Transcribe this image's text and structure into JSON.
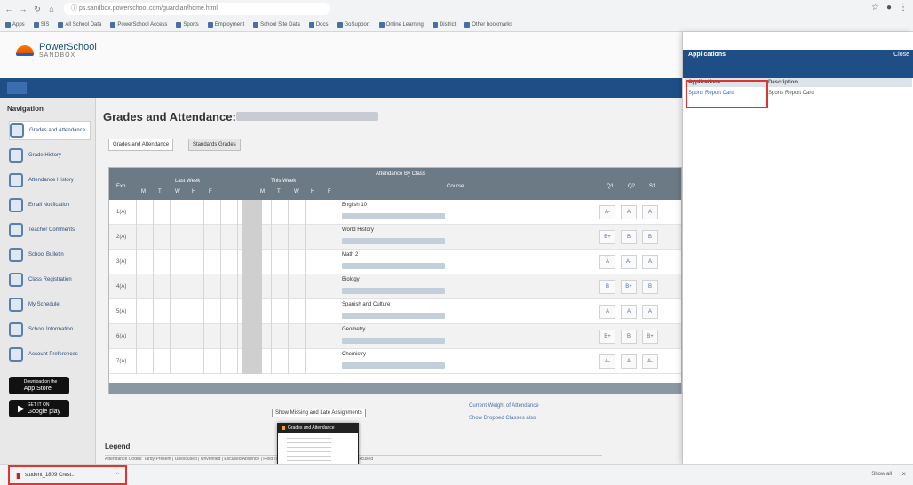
{
  "browser": {
    "url": "ps.sandbox.powerschool.com/guardian/home.html",
    "icons": {
      "back": "back-arrow-icon",
      "forward": "forward-arrow-icon",
      "reload": "reload-icon",
      "home": "home-icon",
      "info": "site-info-icon",
      "star": "bookmark-star-icon",
      "profile": "profile-icon",
      "menu": "kebab-menu-icon"
    },
    "bookmarks": [
      "Apps",
      "SIS",
      "All School Data",
      "PowerSchool Access",
      "Sports",
      "Employment",
      "School Site Data",
      "Docs",
      "GoSupport",
      "Online Learning",
      "District",
      "Other bookmarks"
    ]
  },
  "header": {
    "logo_text": "PowerSchool",
    "logo_sub": "SANDBOX"
  },
  "sidebar": {
    "title": "Navigation",
    "items": [
      {
        "label": "Grades and Attendance",
        "icon": "grades-icon"
      },
      {
        "label": "Grade History",
        "icon": "history-icon"
      },
      {
        "label": "Attendance History",
        "icon": "attendance-icon"
      },
      {
        "label": "Email Notification",
        "icon": "email-icon"
      },
      {
        "label": "Teacher Comments",
        "icon": "comments-icon"
      },
      {
        "label": "School Bulletin",
        "icon": "bulletin-icon"
      },
      {
        "label": "Class Registration",
        "icon": "registration-icon"
      },
      {
        "label": "My Schedule",
        "icon": "schedule-icon"
      },
      {
        "label": "School Information",
        "icon": "school-icon"
      },
      {
        "label": "Account Preferences",
        "icon": "preferences-icon"
      }
    ],
    "app_store": {
      "top": "Download on the",
      "main": "App Store"
    },
    "google_play": {
      "top": "GET IT ON",
      "main": "Google play"
    }
  },
  "main": {
    "title": "Grades and Attendance:",
    "tabs": [
      "Grades and Attendance",
      "Standards Grades"
    ],
    "table": {
      "header_top": "Attendance By Class",
      "header_exp": "Exp",
      "header_last_week": "Last Week",
      "header_this_week": "This Week",
      "header_course": "Course",
      "header_grades": [
        "Q1",
        "Q2",
        "S1"
      ],
      "day_letters": [
        "M",
        "T",
        "W",
        "H",
        "F",
        "M",
        "T",
        "W",
        "H",
        "F"
      ],
      "rows": [
        {
          "exp": "1(A)",
          "course": "English 10",
          "grades": [
            "A-",
            "A",
            "A"
          ]
        },
        {
          "exp": "2(A)",
          "course": "World History",
          "grades": [
            "B+",
            "B",
            "B"
          ]
        },
        {
          "exp": "3(A)",
          "course": "Math 2",
          "grades": [
            "A",
            "A-",
            "A"
          ]
        },
        {
          "exp": "4(A)",
          "course": "Biology",
          "grades": [
            "B",
            "B+",
            "B"
          ]
        },
        {
          "exp": "5(A)",
          "course": "Spanish and Culture",
          "grades": [
            "A",
            "A",
            "A"
          ]
        },
        {
          "exp": "6(A)",
          "course": "Geometry",
          "grades": [
            "B+",
            "B",
            "B+"
          ]
        },
        {
          "exp": "7(A)",
          "course": "Chemistry",
          "grades": [
            "A-",
            "A",
            "A-"
          ]
        }
      ]
    },
    "absent_note": "Show Missing and Late Assignments",
    "attendance_links": [
      "Current Weight of Attendance",
      "Show Dropped Classes also"
    ],
    "legend_title": "Legend",
    "legend_text": "Attendance Codes: Tardy/Present | Unexcused | Unverified | Excused Absence | Field Trip | School Activity | Suspension | Tardy Excused"
  },
  "popup": {
    "title": "Grades and Attendance"
  },
  "apps_panel": {
    "title": "Applications",
    "close": "Close",
    "columns": [
      "Applications",
      "Description"
    ],
    "rows": [
      {
        "app": "Sports Report Card",
        "desc": "Sports Report Card"
      }
    ]
  },
  "download_bar": {
    "file_name": "student_1809 Crest...",
    "show_all": "Show all",
    "close_icon": "close-icon"
  },
  "colors": {
    "brand_blue": "#1f4e87",
    "highlight_red": "#e0342f",
    "logo_orange": "#f57c00"
  }
}
